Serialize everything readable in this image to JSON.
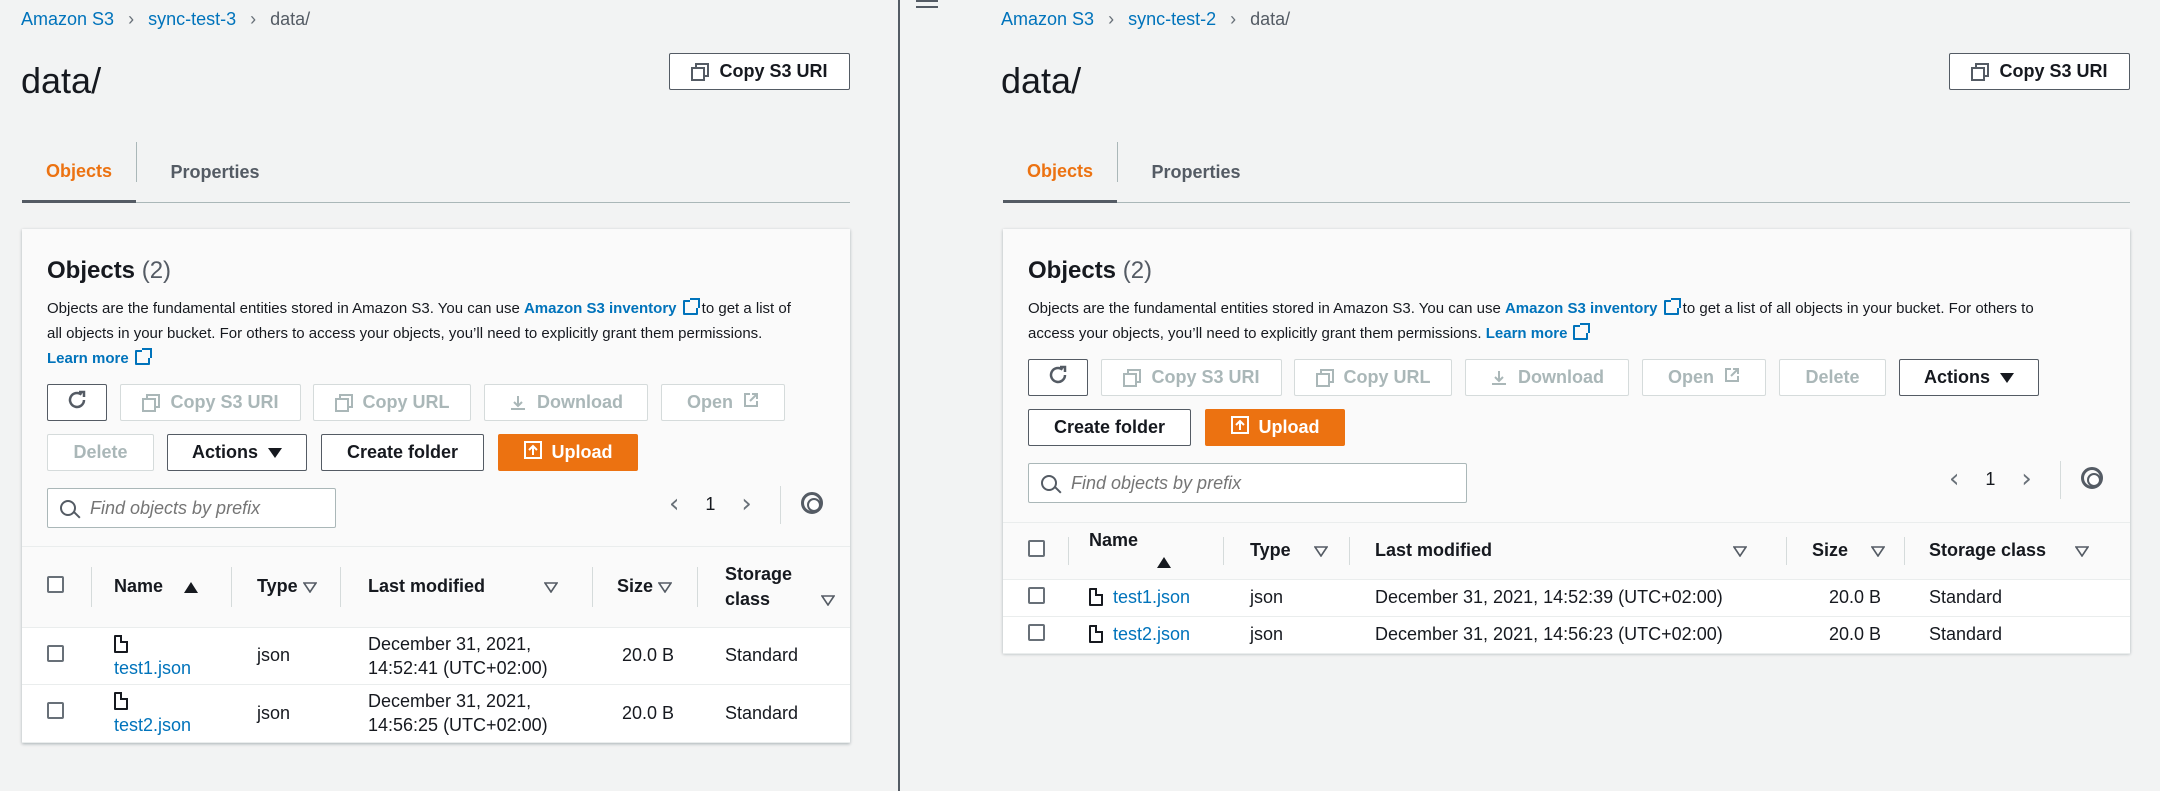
{
  "left": {
    "breadcrumb": [
      "Amazon S3",
      "sync-test-3",
      "data/"
    ],
    "title": "data/",
    "copy_uri_label": "Copy S3 URI",
    "tabs": [
      "Objects",
      "Properties"
    ],
    "objects_title": "Objects",
    "objects_count": "(2)",
    "desc_prefix": "Objects are the fundamental entities stored in Amazon S3. You can use ",
    "desc_link": "Amazon S3 inventory",
    "desc_suffix1": " to get a list of",
    "desc_line2": "all objects in your bucket. For others to access your objects, you’ll need to explicitly grant them permissions.",
    "learn_more": "Learn more",
    "buttons": {
      "copy_uri": "Copy S3 URI",
      "copy_url": "Copy URL",
      "download": "Download",
      "open": "Open",
      "delete": "Delete",
      "actions": "Actions",
      "create_folder": "Create folder",
      "upload": "Upload"
    },
    "search_placeholder": "Find objects by prefix",
    "page": "1",
    "columns": {
      "name": "Name",
      "type": "Type",
      "last_modified": "Last modified",
      "size": "Size",
      "storage_class_1": "Storage",
      "storage_class_2": "class"
    },
    "rows": [
      {
        "name": "test1.json",
        "type": "json",
        "modified_1": "December 31, 2021,",
        "modified_2": "14:52:41 (UTC+02:00)",
        "size": "20.0 B",
        "storage": "Standard"
      },
      {
        "name": "test2.json",
        "type": "json",
        "modified_1": "December 31, 2021,",
        "modified_2": "14:56:25 (UTC+02:00)",
        "size": "20.0 B",
        "storage": "Standard"
      }
    ]
  },
  "right": {
    "breadcrumb": [
      "Amazon S3",
      "sync-test-2",
      "data/"
    ],
    "title": "data/",
    "copy_uri_label": "Copy S3 URI",
    "tabs": [
      "Objects",
      "Properties"
    ],
    "objects_title": "Objects",
    "objects_count": "(2)",
    "desc_prefix": "Objects are the fundamental entities stored in Amazon S3. You can use ",
    "desc_link": "Amazon S3 inventory",
    "desc_suffix1": " to get a list of all objects in your bucket. For others to",
    "desc_line2": "access your objects, you’ll need to explicitly grant them permissions. ",
    "learn_more": "Learn more",
    "buttons": {
      "copy_uri": "Copy S3 URI",
      "copy_url": "Copy URL",
      "download": "Download",
      "open": "Open",
      "delete": "Delete",
      "actions": "Actions",
      "create_folder": "Create folder",
      "upload": "Upload"
    },
    "search_placeholder": "Find objects by prefix",
    "page": "1",
    "columns": {
      "name": "Name",
      "type": "Type",
      "last_modified": "Last modified",
      "size": "Size",
      "storage_class": "Storage class"
    },
    "rows": [
      {
        "name": "test1.json",
        "type": "json",
        "modified": "December 31, 2021, 14:52:39 (UTC+02:00)",
        "size": "20.0 B",
        "storage": "Standard"
      },
      {
        "name": "test2.json",
        "type": "json",
        "modified": "December 31, 2021, 14:56:23 (UTC+02:00)",
        "size": "20.0 B",
        "storage": "Standard"
      }
    ]
  },
  "colors": {
    "accent": "#ec7211",
    "link": "#0073bb",
    "text": "#16191f"
  }
}
